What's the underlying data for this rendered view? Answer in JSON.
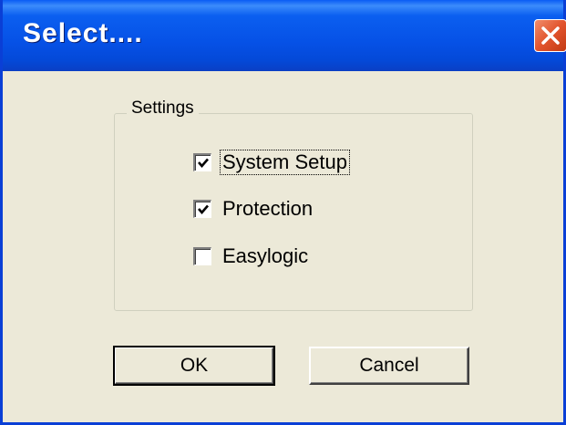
{
  "window": {
    "title": "Select...."
  },
  "group": {
    "label": "Settings",
    "options": [
      {
        "label": "System Setup",
        "checked": true,
        "focused": true
      },
      {
        "label": "Protection",
        "checked": true,
        "focused": false
      },
      {
        "label": "Easylogic",
        "checked": false,
        "focused": false
      }
    ]
  },
  "buttons": {
    "ok_label": "OK",
    "cancel_label": "Cancel"
  },
  "colors": {
    "title_bar": "#0651e6",
    "face": "#ece9d8",
    "close": "#e2542d"
  }
}
